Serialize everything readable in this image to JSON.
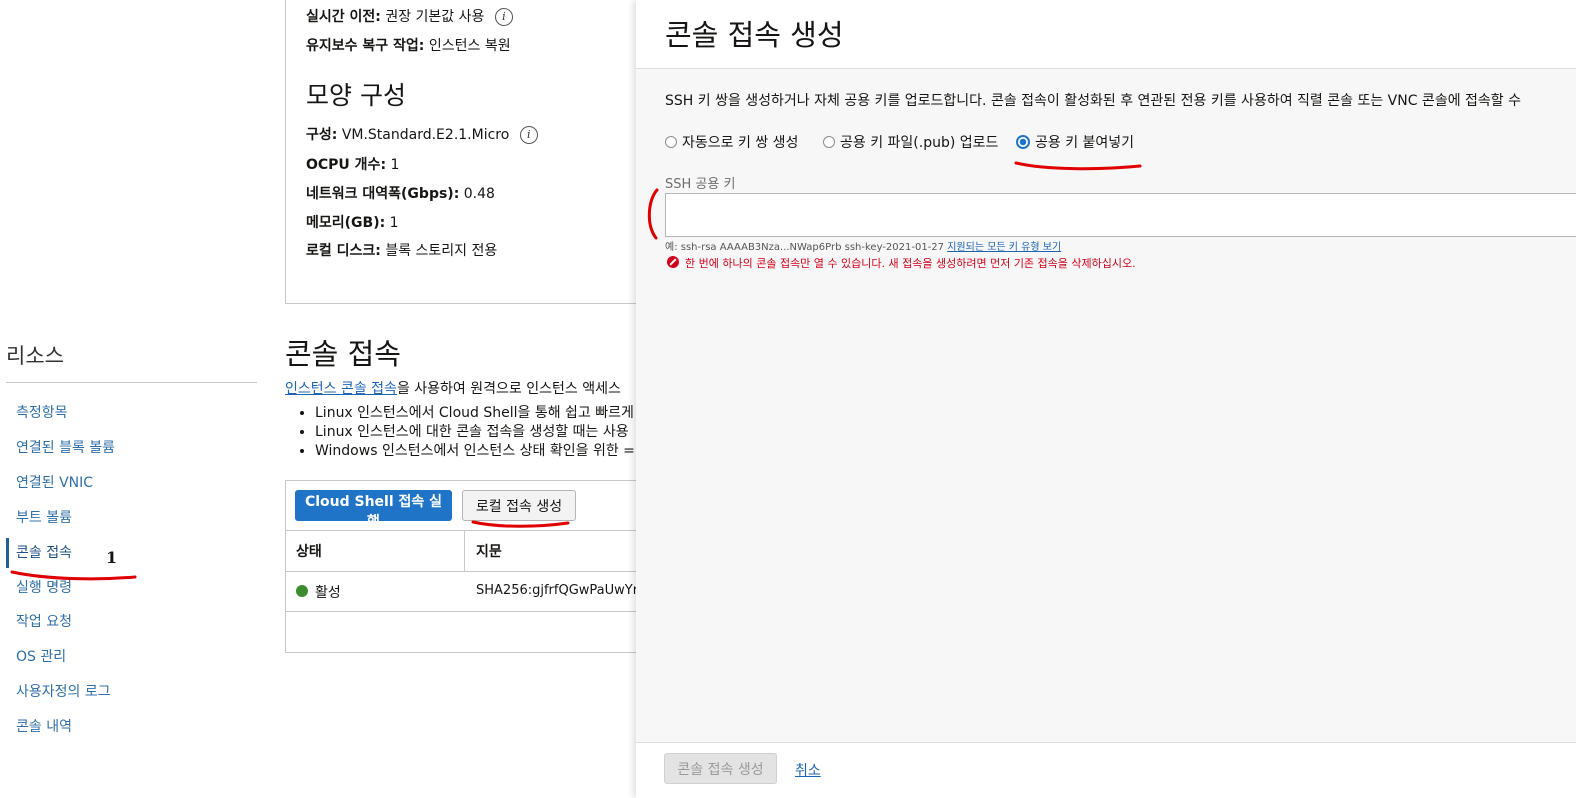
{
  "details": {
    "live_migration_label": "실시간 이전:",
    "live_migration_value": "권장 기본값 사용",
    "maintenance_label": "유지보수 복구 작업:",
    "maintenance_value": "인스턴스 복원",
    "shape_heading": "모양 구성",
    "shape_label": "구성:",
    "shape_value": "VM.Standard.E2.1.Micro",
    "ocpu_label": "OCPU 개수:",
    "ocpu_value": "1",
    "bandwidth_label": "네트워크 대역폭(Gbps):",
    "bandwidth_value": "0.48",
    "memory_label": "메모리(GB):",
    "memory_value": "1",
    "local_disk_label": "로컬 디스크:",
    "local_disk_value": "블록 스토리지 전용"
  },
  "sidebar": {
    "title": "리소스",
    "items": [
      {
        "label": "측정항목"
      },
      {
        "label": "연결된 블록 볼륨"
      },
      {
        "label": "연결된 VNIC"
      },
      {
        "label": "부트 볼륨"
      },
      {
        "label": "콘솔 접속",
        "active": true
      },
      {
        "label": "실행 명령"
      },
      {
        "label": "작업 요청"
      },
      {
        "label": "OS 관리"
      },
      {
        "label": "사용자정의 로그"
      },
      {
        "label": "콘솔 내역"
      }
    ]
  },
  "console": {
    "heading": "콘솔 접속",
    "desc_link": "인스턴스 콘솔 접속",
    "desc_rest": "을 사용하여 원격으로 인스턴스 액세스",
    "bullets": [
      "Linux 인스턴스에서 Cloud Shell을 통해 쉽고 빠르게",
      "Linux 인스턴스에 대한 콘솔 접속을 생성할 때는 사용",
      "Windows 인스턴스에서 인스턴스 상태 확인을 위한 ="
    ],
    "cloud_shell_button": "Cloud Shell 접속 실행",
    "local_connection_button": "로컬 접속 생성",
    "table": {
      "headers": [
        "상태",
        "지문"
      ],
      "rows": [
        {
          "status": "활성",
          "fingerprint": "SHA256:gjfrfQGwPaUwYr"
        }
      ]
    }
  },
  "panel": {
    "title": "콘솔 접속 생성",
    "description": "SSH 키 쌍을 생성하거나 자체 공용 키를 업로드합니다. 콘솔 접속이 활성화된 후 연관된 전용 키를 사용하여 직렬 콘솔 또는 VNC 콘솔에 접속할 수",
    "radio_options": [
      {
        "label": "자동으로 키 쌍 생성",
        "checked": false
      },
      {
        "label": "공용 키 파일(.pub) 업로드",
        "checked": false
      },
      {
        "label": "공용 키 붙여넣기",
        "checked": true
      }
    ],
    "ssh_key_label": "SSH 공용 키",
    "ssh_key_value": "",
    "example_text": "예: ssh-rsa AAAAB3Nza...NWap6Prb ssh-key-2021-01-27",
    "example_link": "지원되는 모든 키 유형 보기",
    "error_text": "한 번에 하나의 콘솔 접속만 열 수 있습니다. 새 접속을 생성하려면 먼저 기존 접속을 삭제하십시오.",
    "create_button": "콘솔 접속 생성",
    "cancel_link": "취소"
  },
  "annotation": {
    "number": "1"
  },
  "colors": {
    "primary": "#1f74c7",
    "link": "#1c64b4",
    "error": "#d0021b",
    "active_status": "#3c8c2f",
    "annotation": "#e00000"
  }
}
